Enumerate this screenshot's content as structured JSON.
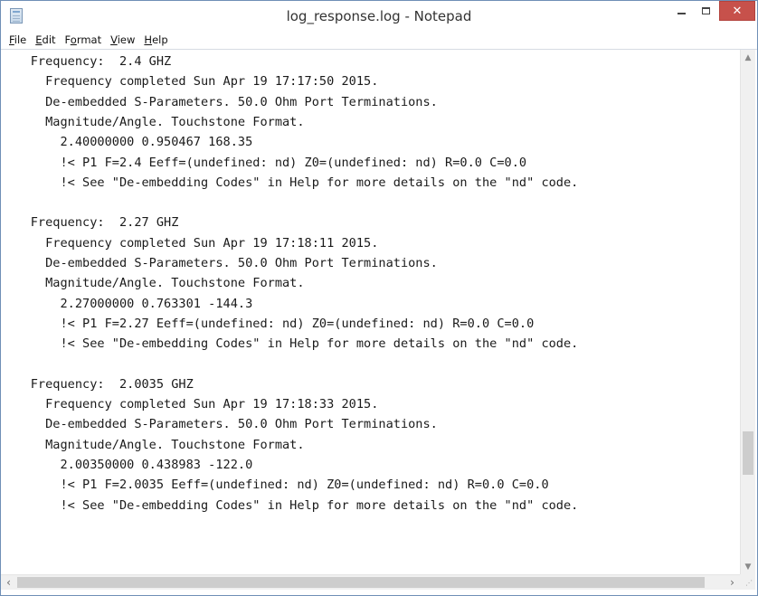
{
  "window": {
    "title": "log_response.log - Notepad",
    "close_glyph": "✕",
    "accent_close": "#c7514b"
  },
  "menu": {
    "items": [
      {
        "label": "File",
        "mnemonic": "F",
        "rest": "ile"
      },
      {
        "label": "Edit",
        "mnemonic": "E",
        "rest": "dit"
      },
      {
        "label": "Format",
        "mnemonic": "o",
        "pre": "F",
        "rest": "rmat"
      },
      {
        "label": "View",
        "mnemonic": "V",
        "rest": "iew"
      },
      {
        "label": "Help",
        "mnemonic": "H",
        "rest": "elp"
      }
    ]
  },
  "document": {
    "lines": [
      "    Frequency:  2.4 GHZ",
      "      Frequency completed Sun Apr 19 17:17:50 2015.",
      "      De-embedded S-Parameters. 50.0 Ohm Port Terminations.",
      "      Magnitude/Angle. Touchstone Format.",
      "        2.40000000 0.950467 168.35",
      "        !< P1 F=2.4 Eeff=(undefined: nd) Z0=(undefined: nd) R=0.0 C=0.0",
      "        !< See \"De-embedding Codes\" in Help for more details on the \"nd\" code.",
      "",
      "    Frequency:  2.27 GHZ",
      "      Frequency completed Sun Apr 19 17:18:11 2015.",
      "      De-embedded S-Parameters. 50.0 Ohm Port Terminations.",
      "      Magnitude/Angle. Touchstone Format.",
      "        2.27000000 0.763301 -144.3",
      "        !< P1 F=2.27 Eeff=(undefined: nd) Z0=(undefined: nd) R=0.0 C=0.0",
      "        !< See \"De-embedding Codes\" in Help for more details on the \"nd\" code.",
      "",
      "    Frequency:  2.0035 GHZ",
      "      Frequency completed Sun Apr 19 17:18:33 2015.",
      "      De-embedded S-Parameters. 50.0 Ohm Port Terminations.",
      "      Magnitude/Angle. Touchstone Format.",
      "        2.00350000 0.438983 -122.0",
      "        !< P1 F=2.0035 Eeff=(undefined: nd) Z0=(undefined: nd) R=0.0 C=0.0",
      "        !< See \"De-embedding Codes\" in Help for more details on the \"nd\" code."
    ]
  },
  "icons": {
    "app": "notepad-icon",
    "minimize": "minimize-icon",
    "maximize": "maximize-icon",
    "close": "close-icon",
    "scroll_up": "▲",
    "scroll_down": "▼",
    "scroll_left": "‹",
    "scroll_right": "›",
    "grip": "⋰"
  }
}
